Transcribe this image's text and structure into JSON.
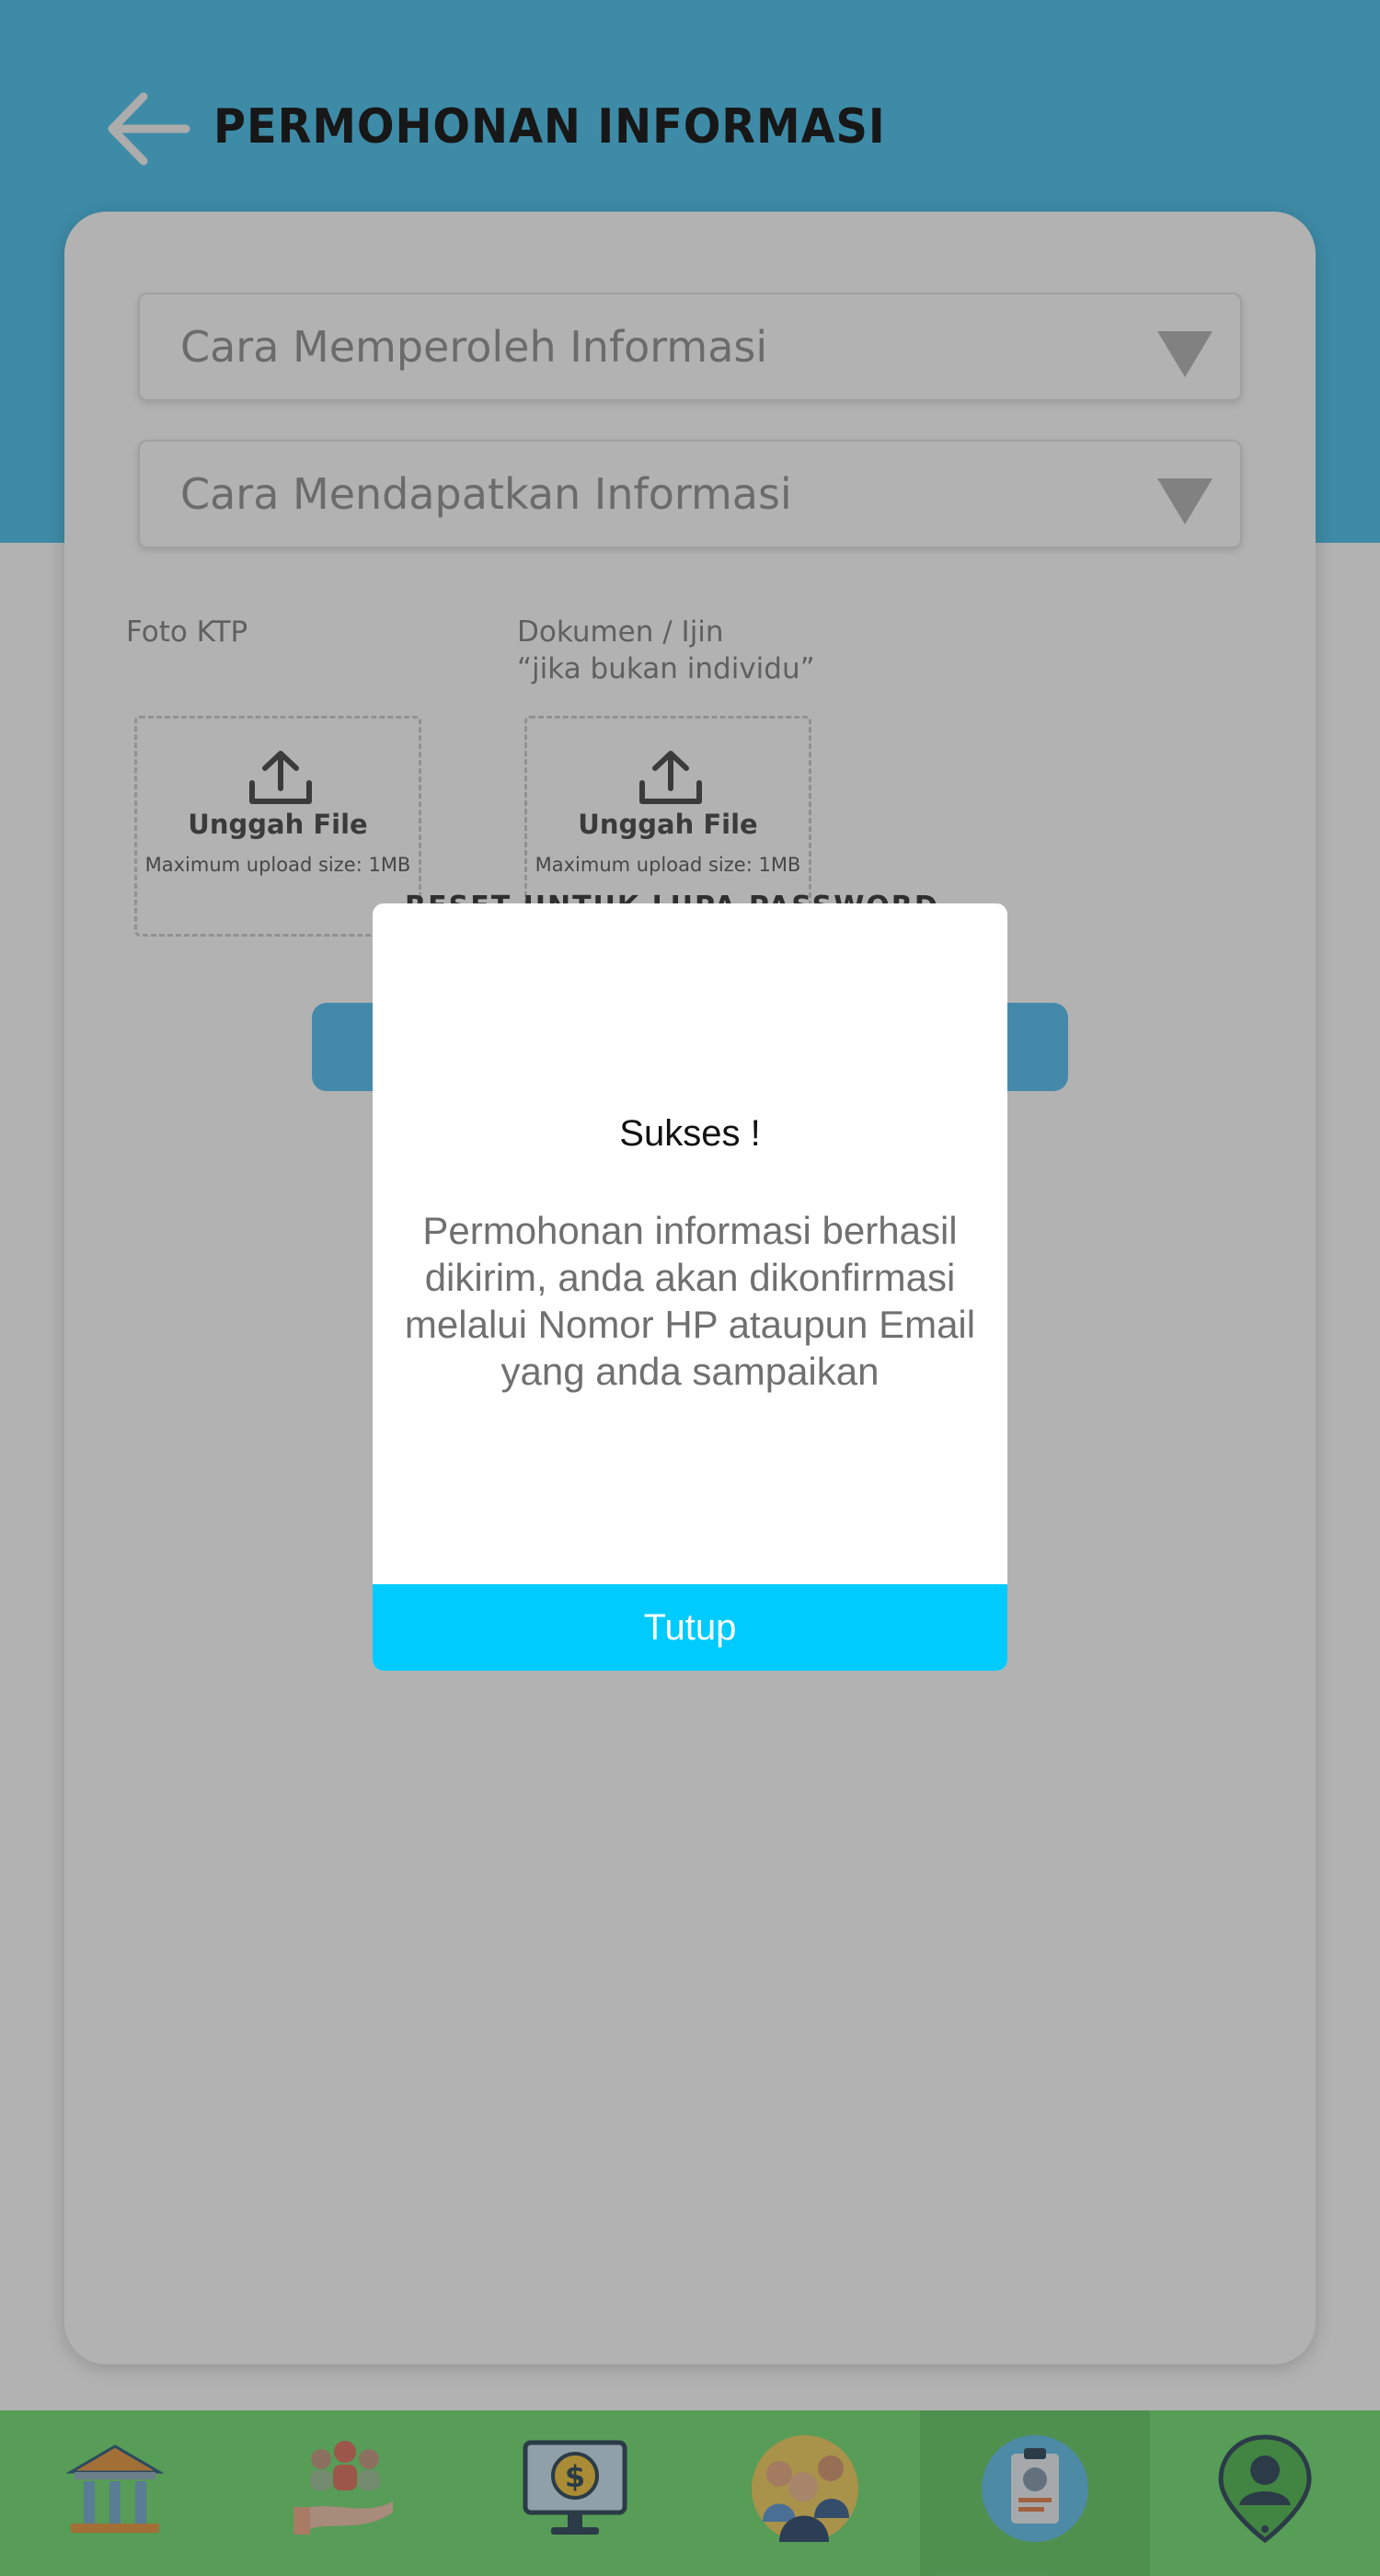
{
  "header": {
    "title": "PERMOHONAN INFORMASI",
    "back_icon": "arrow-left-icon"
  },
  "form": {
    "select_1": {
      "placeholder": "Cara Memperoleh Informasi",
      "icon": "dropdown-triangle-icon"
    },
    "select_2": {
      "placeholder": "Cara Mendapatkan Informasi",
      "icon": "dropdown-triangle-icon"
    },
    "upload_ktp": {
      "label": "Foto KTP",
      "button_label": "Unggah File",
      "note": "Maximum upload size: 1MB",
      "icon": "upload-icon"
    },
    "upload_dokumen": {
      "label_line1": "Dokumen / Ijin",
      "label_line2": "“jika bukan individu”",
      "button_label": "Unggah File",
      "note": "Maximum upload size: 1MB",
      "icon": "upload-icon"
    },
    "partially_hidden_text": "RESET UNTUK LUPA PASSWORD"
  },
  "modal": {
    "title": "Sukses !",
    "message": "Permohonan informasi berhasil dikirim, anda akan dikonfirmasi melalui Nomor HP ataupun Email yang anda sampaikan",
    "close_label": "Tutup"
  },
  "bottom_nav": {
    "items": [
      {
        "icon": "bank-building-icon"
      },
      {
        "icon": "community-hand-icon"
      },
      {
        "icon": "finance-monitor-icon"
      },
      {
        "icon": "people-group-icon"
      },
      {
        "icon": "id-card-icon",
        "active": true
      },
      {
        "icon": "user-location-pin-icon"
      }
    ]
  },
  "colors": {
    "header_bg": "#59c7f0",
    "bottom_nav_bg": "#7de07d",
    "modal_button": "#00cbff",
    "overlay": "rgba(0,0,0,0.30)"
  }
}
